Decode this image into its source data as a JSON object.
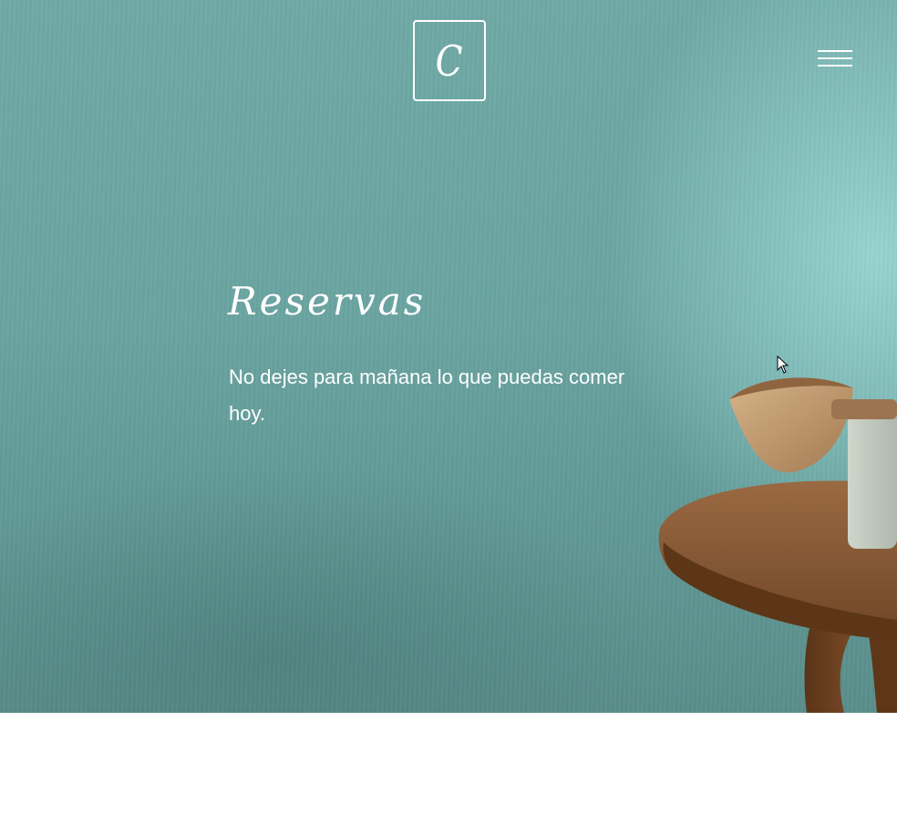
{
  "header": {
    "logo_letter": "C"
  },
  "hero": {
    "title": "Reservas",
    "subtitle": "No dejes para mañana lo que puedas comer hoy."
  },
  "icons": {
    "menu": "hamburger-menu-icon",
    "cursor": "mouse-pointer-icon"
  },
  "colors": {
    "hero_background": "#6aa4a1",
    "text": "#ffffff",
    "page_background": "#ffffff"
  }
}
